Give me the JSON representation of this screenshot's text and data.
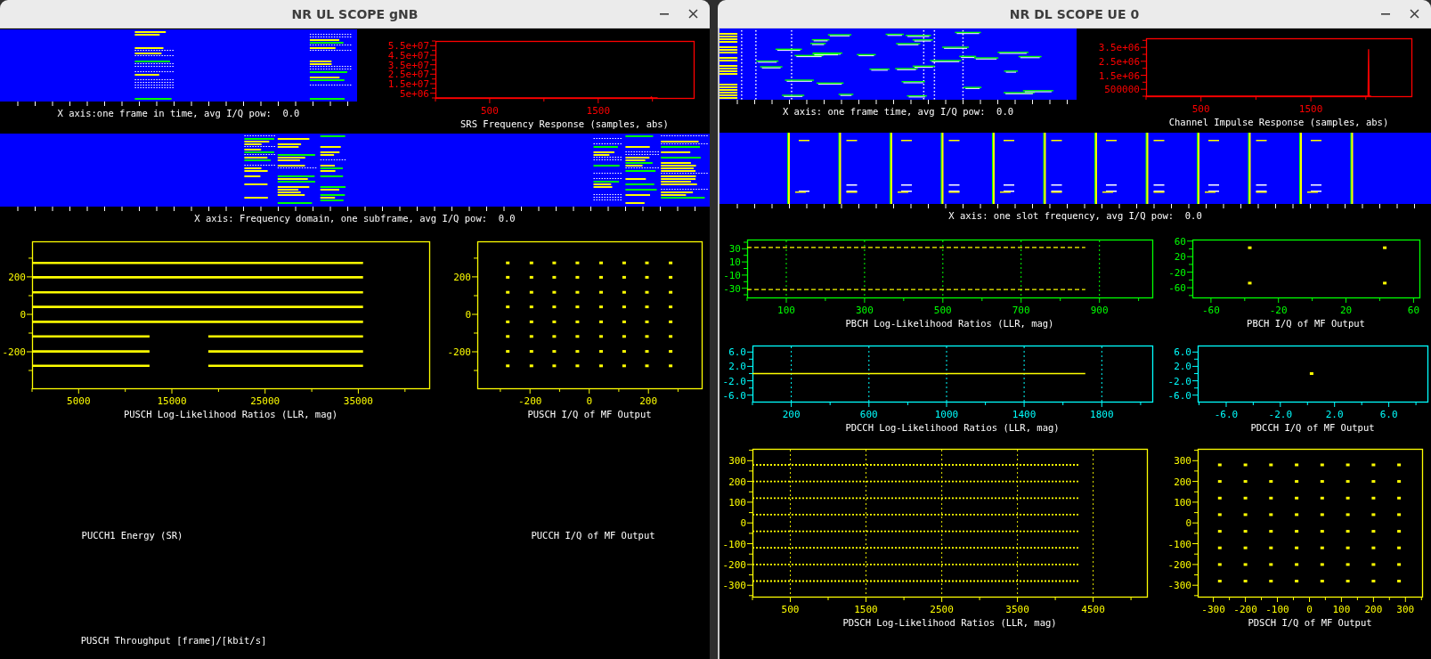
{
  "windows": [
    {
      "title": "NR UL SCOPE gNB",
      "rows": [
        {
          "panels": [
            {
              "kind": "waterfall",
              "caption": "X axis:one frame in time, avg I/Q pow:  0.0"
            },
            {
              "kind": "chart",
              "chart_data": {
                "type": "line",
                "xlabel": "SRS Frequency Response (samples, abs)",
                "x": [
                  0,
                  1980,
                  1990,
                  2000,
                  2048
                ],
                "series": [
                  {
                    "color": "#ff0000",
                    "values": [
                      0,
                      0,
                      1000000,
                      0,
                      0
                    ]
                  }
                ],
                "xlim": [
                  0,
                  2380
                ],
                "ylim": [
                  0,
                  60000000
                ],
                "xticks": [
                  500,
                  1500
                ],
                "yticks": [
                  {
                    "value": 5000000,
                    "label": "5e+06"
                  },
                  {
                    "value": 15000000,
                    "label": "1.5e+07"
                  },
                  {
                    "value": 25000000,
                    "label": "2.5e+07"
                  },
                  {
                    "value": 35000000,
                    "label": "3.5e+07"
                  },
                  {
                    "value": 45000000,
                    "label": "4.5e+07"
                  },
                  {
                    "value": 55000000,
                    "label": "5.5e+07"
                  }
                ]
              }
            }
          ]
        },
        {
          "panels": [
            {
              "kind": "waterfall",
              "caption": "X axis: Frequency domain, one subframe, avg I/Q pow:  0.0"
            }
          ]
        },
        {
          "panels": [
            {
              "kind": "chart",
              "chart_data": {
                "type": "line",
                "xlabel": "PUSCH Log-Likelihood Ratios (LLR, mag)",
                "x": [
                  0,
                  12600,
                  12601,
                  18900,
                  35500
                ],
                "series": [
                  {
                    "color": "#ffff00",
                    "values": [
                      275,
                      275,
                      275,
                      275,
                      275
                    ]
                  },
                  {
                    "color": "#ffff00",
                    "values": [
                      198,
                      198,
                      198,
                      198,
                      198
                    ]
                  },
                  {
                    "color": "#ffff00",
                    "values": [
                      118,
                      118,
                      118,
                      118,
                      118
                    ]
                  },
                  {
                    "color": "#ffff00",
                    "values": [
                      40,
                      40,
                      40,
                      40,
                      40
                    ]
                  },
                  {
                    "color": "#ffff00",
                    "values": [
                      -40,
                      -40,
                      -40,
                      -40,
                      -40
                    ]
                  },
                  {
                    "color": "#ffff00",
                    "values": [
                      -118,
                      -118,
                      null,
                      -118,
                      -118
                    ]
                  },
                  {
                    "color": "#ffff00",
                    "values": [
                      -198,
                      -198,
                      null,
                      -198,
                      -198
                    ]
                  },
                  {
                    "color": "#ffff00",
                    "values": [
                      -275,
                      -275,
                      null,
                      -275,
                      -275
                    ]
                  }
                ],
                "xlim": [
                  0,
                  42600
                ],
                "ylim": [
                  -395,
                  390
                ],
                "xticks": [
                  5000,
                  15000,
                  25000,
                  35000
                ],
                "yticks": [
                  -200,
                  0,
                  200
                ]
              }
            },
            {
              "kind": "chart",
              "chart_data": {
                "type": "scatter",
                "xlabel": "PUSCH I/Q of MF Output",
                "x": [
                  -275,
                  -195,
                  -118,
                  -40,
                  40,
                  118,
                  195,
                  275
                ],
                "series": [
                  {
                    "color": "#ffff00",
                    "values": [
                      275,
                      275,
                      275,
                      275,
                      275,
                      275,
                      275,
                      275
                    ]
                  },
                  {
                    "color": "#ffff00",
                    "values": [
                      198,
                      198,
                      198,
                      198,
                      198,
                      198,
                      198,
                      198
                    ]
                  },
                  {
                    "color": "#ffff00",
                    "values": [
                      118,
                      118,
                      118,
                      118,
                      118,
                      118,
                      118,
                      118
                    ]
                  },
                  {
                    "color": "#ffff00",
                    "values": [
                      40,
                      40,
                      40,
                      40,
                      40,
                      40,
                      40,
                      40
                    ]
                  },
                  {
                    "color": "#ffff00",
                    "values": [
                      -40,
                      -40,
                      -40,
                      -40,
                      -40,
                      -40,
                      -40,
                      -40
                    ]
                  },
                  {
                    "color": "#ffff00",
                    "values": [
                      -118,
                      -118,
                      -118,
                      -118,
                      -118,
                      -118,
                      -118,
                      -118
                    ]
                  },
                  {
                    "color": "#ffff00",
                    "values": [
                      -198,
                      -198,
                      -198,
                      -198,
                      -198,
                      -198,
                      -198,
                      -198
                    ]
                  },
                  {
                    "color": "#ffff00",
                    "values": [
                      -275,
                      -275,
                      -275,
                      -275,
                      -275,
                      -275,
                      -275,
                      -275
                    ]
                  }
                ],
                "xlim": [
                  -378,
                  380
                ],
                "ylim": [
                  -395,
                  390
                ],
                "xticks": [
                  -200,
                  0,
                  200
                ],
                "yticks": [
                  -200,
                  0,
                  200
                ]
              }
            }
          ]
        },
        {
          "panels": [
            {
              "kind": "empty",
              "caption": "PUCCH1 Energy (SR)"
            },
            {
              "kind": "empty",
              "caption": "PUCCH I/Q of MF Output"
            }
          ]
        },
        {
          "panels": [
            {
              "kind": "empty",
              "caption": "PUSCH Throughput [frame]/[kbit/s]"
            }
          ]
        }
      ]
    },
    {
      "title": "NR DL SCOPE UE 0",
      "rows": [
        {
          "panels": [
            {
              "kind": "waterfall",
              "caption": "X axis: one frame time, avg I/Q pow:  0.0"
            },
            {
              "kind": "chart",
              "chart_data": {
                "type": "line",
                "xlabel": "Channel Impulse Response (samples, abs)",
                "x": [
                  0,
                  2020,
                  2025,
                  2030,
                  2048
                ],
                "series": [
                  {
                    "color": "#ff0000",
                    "values": [
                      0,
                      0,
                      3370000,
                      0,
                      0
                    ]
                  }
                ],
                "xlim": [
                  0,
                  2415
                ],
                "ylim": [
                  0,
                  4150000
                ],
                "xticks": [
                  500,
                  1500
                ],
                "yticks": [
                  500000,
                  {
                    "value": 1500000,
                    "label": "1.5e+06"
                  },
                  {
                    "value": 2500000,
                    "label": "2.5e+06"
                  },
                  {
                    "value": 3500000,
                    "label": "3.5e+06"
                  }
                ]
              }
            }
          ]
        },
        {
          "panels": [
            {
              "kind": "waterfall",
              "caption": "X axis: one slot frequency, avg I/Q pow:  0.0"
            }
          ]
        },
        {
          "panels": [
            {
              "kind": "chart",
              "chart_data": {
                "type": "line",
                "xlabel": "PBCH Log-Likelihood Ratios (LLR, mag)",
                "x": [
                  0,
                  864
                ],
                "series": [
                  {
                    "color": "#ffff00",
                    "line_style": "dashed",
                    "values": [
                      32,
                      32
                    ]
                  },
                  {
                    "color": "#ffff00",
                    "line_style": "dashed",
                    "values": [
                      -32,
                      -32
                    ]
                  }
                ],
                "grid": true,
                "xlim": [
                  0,
                  1035
                ],
                "ylim": [
                  -44,
                  44
                ],
                "xticks": [
                  100,
                  300,
                  500,
                  700,
                  900
                ],
                "yticks": [
                  -30,
                  -10,
                  10,
                  30
                ]
              }
            },
            {
              "kind": "chart",
              "chart_data": {
                "type": "scatter",
                "xlabel": "PBCH I/Q of MF Output",
                "x": [
                  -37,
                  43
                ],
                "series": [
                  {
                    "color": "#ffff00",
                    "values": [
                      43,
                      43
                    ]
                  },
                  {
                    "color": "#ffff00",
                    "values": [
                      -48,
                      -48
                    ]
                  }
                ],
                "xlim": [
                  -71,
                  63.5
                ],
                "ylim": [
                  -85,
                  64
                ],
                "xticks": [
                  -60,
                  -20,
                  20,
                  60
                ],
                "yticks": [
                  -60,
                  -20,
                  20,
                  60
                ]
              }
            }
          ]
        },
        {
          "panels": [
            {
              "kind": "chart",
              "chart_data": {
                "type": "line",
                "xlabel": "PDCCH Log-Likelihood Ratios (LLR, mag)",
                "x": [
                  0,
                  1715
                ],
                "series": [
                  {
                    "color": "#ffff00",
                    "values": [
                      0,
                      0
                    ]
                  }
                ],
                "grid": true,
                "xlim": [
                  0,
                  2060
                ],
                "ylim": [
                  -7.8,
                  7.8
                ],
                "xticks": [
                  200,
                  600,
                  1000,
                  1400,
                  1800
                ],
                "yticks": [
                  {
                    "value": -6,
                    "label": "-6.0"
                  },
                  {
                    "value": -2,
                    "label": "-2.0"
                  },
                  {
                    "value": 2,
                    "label": "2.0"
                  },
                  {
                    "value": 6,
                    "label": "6.0"
                  }
                ]
              }
            },
            {
              "kind": "chart",
              "chart_data": {
                "type": "scatter",
                "xlabel": "PDCCH I/Q of MF Output",
                "x": [
                  0.3
                ],
                "series": [
                  {
                    "color": "#ffff00",
                    "values": [
                      0
                    ]
                  }
                ],
                "xlim": [
                  -8.1,
                  8.85
                ],
                "ylim": [
                  -7.8,
                  7.8
                ],
                "xticks": [
                  {
                    "value": -6,
                    "label": "-6.0"
                  },
                  {
                    "value": -2,
                    "label": "-2.0"
                  },
                  {
                    "value": 2,
                    "label": "2.0"
                  },
                  {
                    "value": 6,
                    "label": "6.0"
                  }
                ],
                "yticks": [
                  {
                    "value": -6,
                    "label": "-6.0"
                  },
                  {
                    "value": -2,
                    "label": "-2.0"
                  },
                  {
                    "value": 2,
                    "label": "2.0"
                  },
                  {
                    "value": 6,
                    "label": "6.0"
                  }
                ]
              }
            }
          ]
        },
        {
          "panels": [
            {
              "kind": "chart",
              "chart_data": {
                "type": "line",
                "xlabel": "PDSCH Log-Likelihood Ratios (LLR, mag)",
                "x": [
                  0,
                  4320
                ],
                "series": [
                  {
                    "color": "#ffff00",
                    "line_style": "dotted",
                    "values": [
                      280,
                      280
                    ]
                  },
                  {
                    "color": "#ffff00",
                    "line_style": "dotted",
                    "values": [
                      200,
                      200
                    ]
                  },
                  {
                    "color": "#ffff00",
                    "line_style": "dotted",
                    "values": [
                      120,
                      120
                    ]
                  },
                  {
                    "color": "#ffff00",
                    "line_style": "dotted",
                    "values": [
                      40,
                      40
                    ]
                  },
                  {
                    "color": "#ffff00",
                    "line_style": "dotted",
                    "values": [
                      -40,
                      -40
                    ]
                  },
                  {
                    "color": "#ffff00",
                    "line_style": "dotted",
                    "values": [
                      -120,
                      -120
                    ]
                  },
                  {
                    "color": "#ffff00",
                    "line_style": "dotted",
                    "values": [
                      -200,
                      -200
                    ]
                  },
                  {
                    "color": "#ffff00",
                    "line_style": "dotted",
                    "values": [
                      -280,
                      -280
                    ]
                  }
                ],
                "grid": true,
                "xlim": [
                  0,
                  5210
                ],
                "ylim": [
                  -355,
                  357
                ],
                "xticks": [
                  500,
                  1500,
                  2500,
                  3500,
                  4500
                ],
                "yticks": [
                  -300,
                  -200,
                  -100,
                  0,
                  100,
                  200,
                  300
                ]
              }
            },
            {
              "kind": "chart",
              "chart_data": {
                "type": "scatter",
                "xlabel": "PDSCH I/Q of MF Output",
                "x": [
                  -280,
                  -200,
                  -120,
                  -40,
                  40,
                  120,
                  200,
                  280
                ],
                "series": [
                  {
                    "color": "#ffff00",
                    "values": [
                      280,
                      280,
                      280,
                      280,
                      280,
                      280,
                      280,
                      280
                    ]
                  },
                  {
                    "color": "#ffff00",
                    "values": [
                      200,
                      200,
                      200,
                      200,
                      200,
                      200,
                      200,
                      200
                    ]
                  },
                  {
                    "color": "#ffff00",
                    "values": [
                      120,
                      120,
                      120,
                      120,
                      120,
                      120,
                      120,
                      120
                    ]
                  },
                  {
                    "color": "#ffff00",
                    "values": [
                      40,
                      40,
                      40,
                      40,
                      40,
                      40,
                      40,
                      40
                    ]
                  },
                  {
                    "color": "#ffff00",
                    "values": [
                      -40,
                      -40,
                      -40,
                      -40,
                      -40,
                      -40,
                      -40,
                      -40
                    ]
                  },
                  {
                    "color": "#ffff00",
                    "values": [
                      -120,
                      -120,
                      -120,
                      -120,
                      -120,
                      -120,
                      -120,
                      -120
                    ]
                  },
                  {
                    "color": "#ffff00",
                    "values": [
                      -200,
                      -200,
                      -200,
                      -200,
                      -200,
                      -200,
                      -200,
                      -200
                    ]
                  },
                  {
                    "color": "#ffff00",
                    "values": [
                      -280,
                      -280,
                      -280,
                      -280,
                      -280,
                      -280,
                      -280,
                      -280
                    ]
                  }
                ],
                "xlim": [
                  -349,
                  352
                ],
                "ylim": [
                  -355,
                  357
                ],
                "xticks": [
                  -300,
                  -200,
                  -100,
                  0,
                  100,
                  200,
                  300
                ],
                "yticks": [
                  -300,
                  -200,
                  -100,
                  0,
                  100,
                  200,
                  300
                ]
              }
            }
          ]
        }
      ]
    }
  ]
}
